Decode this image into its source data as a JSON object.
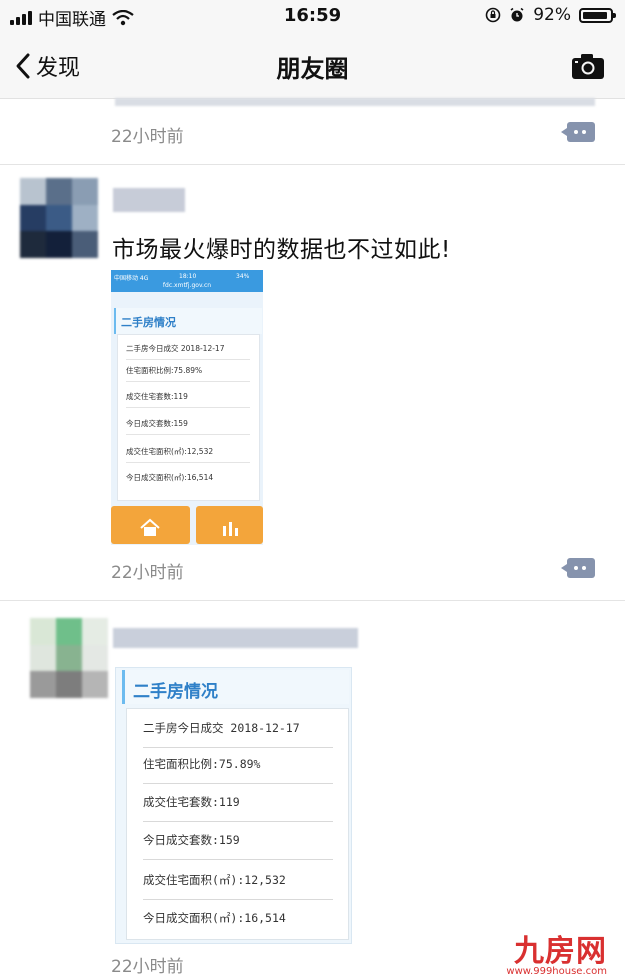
{
  "status": {
    "carrier": "中国联通",
    "time": "16:59",
    "battery": "92%"
  },
  "nav": {
    "back_label": "发现",
    "title": "朋友圈"
  },
  "posts": [
    {
      "time": "22小时前"
    },
    {
      "text": "市场最火爆时的数据也不过如此!",
      "time": "22小时前",
      "screenshot": {
        "carrier": "中国移动 4G",
        "clock": "18:10",
        "battery": "34%",
        "url": "fdc.xmtfj.gov.cn",
        "section_title": "二手房情况",
        "rows": [
          "二手房今日成交 2018-12-17",
          "住宅面积比例:75.89%",
          "成交住宅套数:119",
          "今日成交套数:159",
          "成交住宅面积(㎡):12,532",
          "今日成交面积(㎡):16,514"
        ]
      }
    },
    {
      "time": "22小时前",
      "image": {
        "section_title": "二手房情况",
        "rows": [
          "二手房今日成交 2018-12-17",
          "住宅面积比例:75.89%",
          "成交住宅套数:119",
          "今日成交套数:159",
          "成交住宅面积(㎡):12,532",
          "今日成交面积(㎡):16,514"
        ]
      }
    }
  ],
  "watermark": {
    "logo": "九房网",
    "url": "www.999house.com"
  }
}
